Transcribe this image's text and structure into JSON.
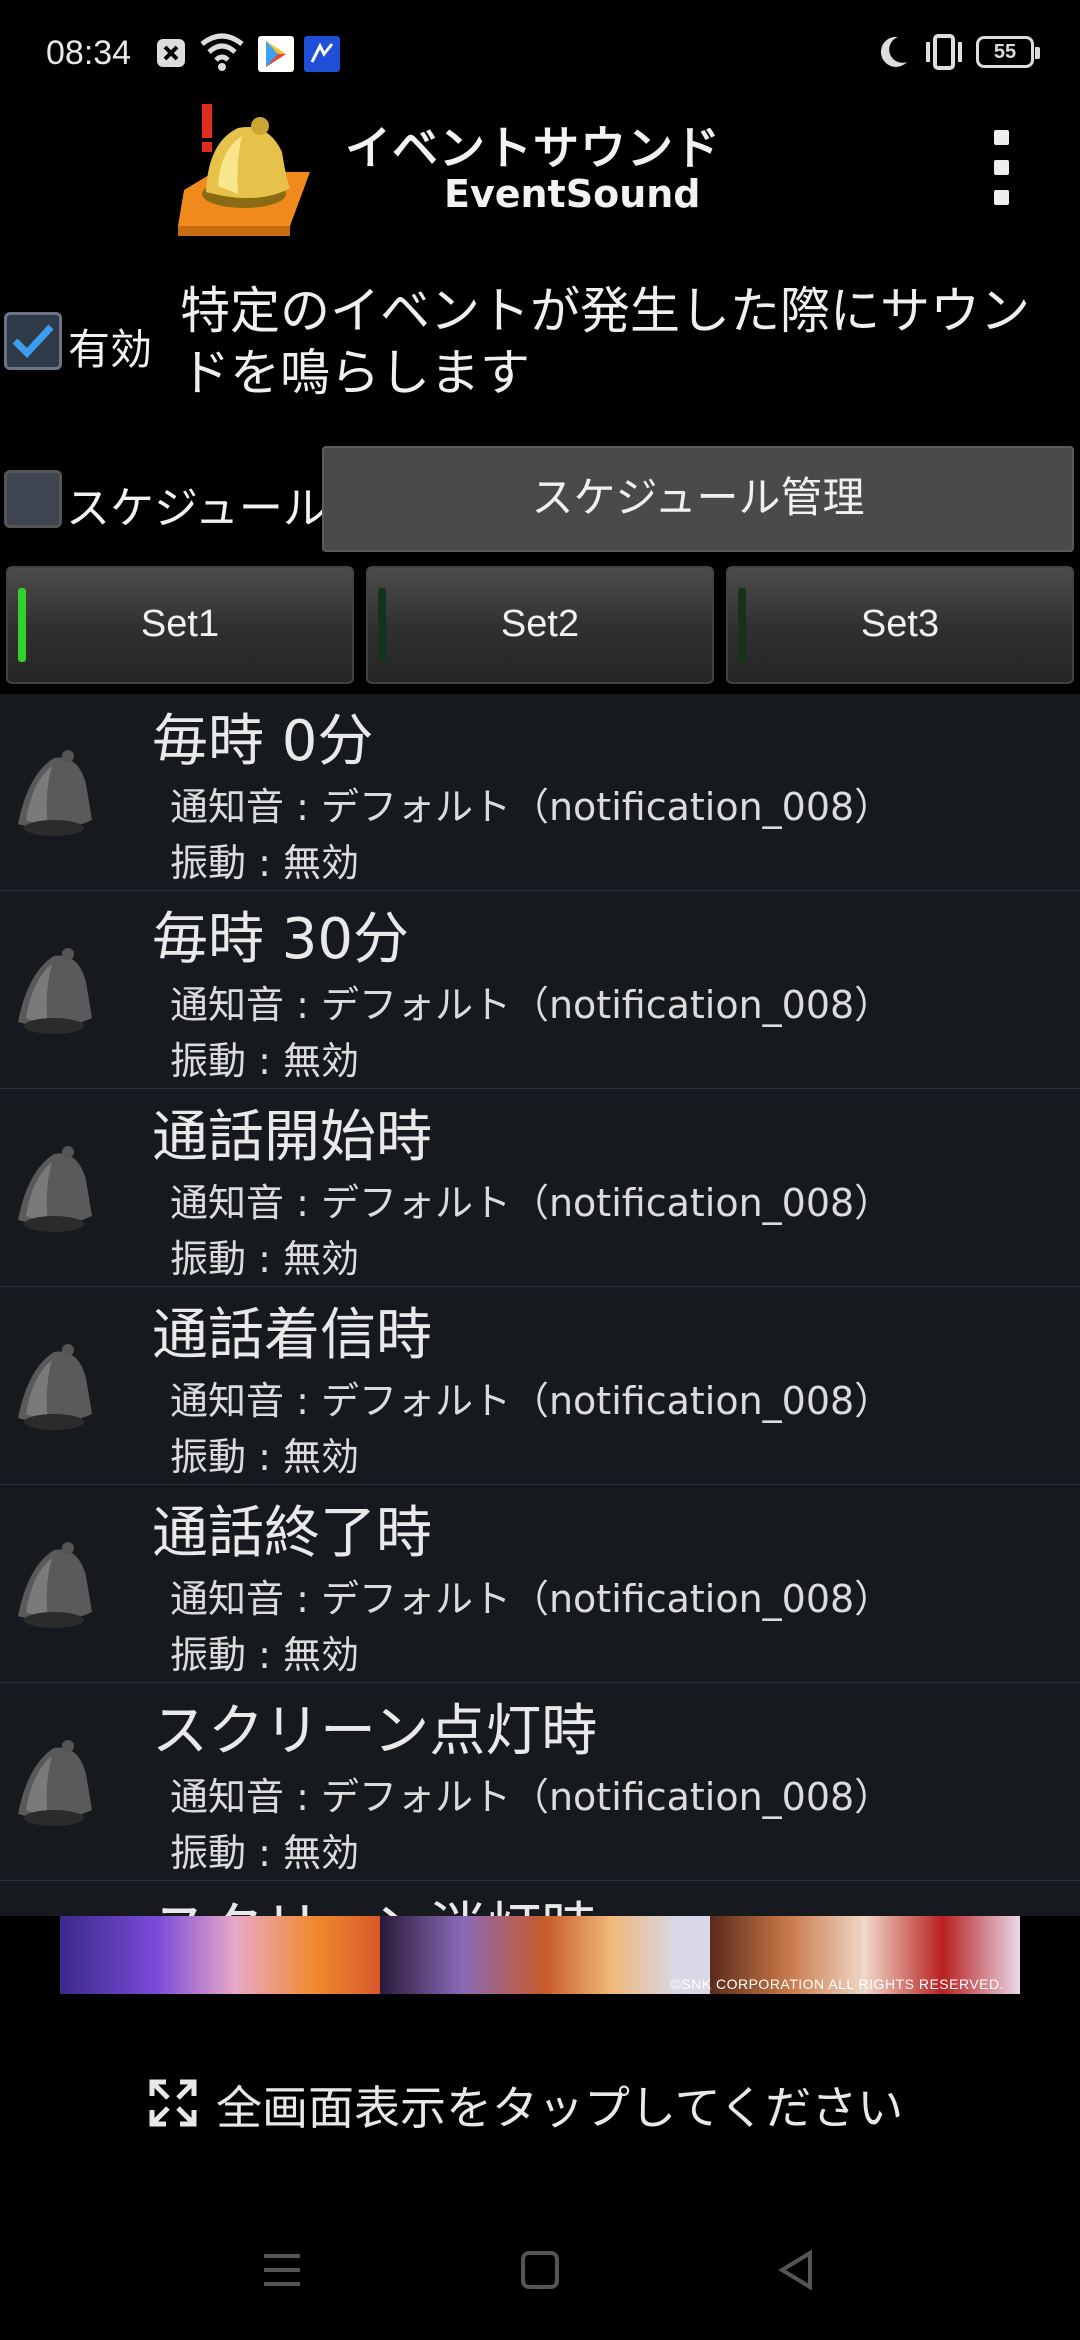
{
  "status_bar": {
    "time": "08:34",
    "battery": "55",
    "icons": [
      "close-box-icon",
      "wifi-icon",
      "play-store-icon",
      "app-notification-icon",
      "moon-icon",
      "vibrate-icon",
      "battery-icon"
    ]
  },
  "header": {
    "title_jp": "イベントサウンド",
    "title_en": "EventSound",
    "menu_icon": "overflow-menu-icon"
  },
  "enable": {
    "checked": true,
    "label": "有効",
    "description": "特定のイベントが発生した際にサウンドを鳴らします"
  },
  "schedule": {
    "checked": false,
    "label": "スケジュール",
    "manage_button": "スケジュール管理"
  },
  "sets": [
    {
      "label": "Set1",
      "active": true
    },
    {
      "label": "Set2",
      "active": false
    },
    {
      "label": "Set3",
      "active": false
    }
  ],
  "events": [
    {
      "title": "毎時 0分",
      "sound": "通知音 : デフォルト（notification_008）",
      "vibration": "振動 : 無効"
    },
    {
      "title": "毎時 30分",
      "sound": "通知音 : デフォルト（notification_008）",
      "vibration": "振動 : 無効"
    },
    {
      "title": "通話開始時",
      "sound": "通知音 : デフォルト（notification_008）",
      "vibration": "振動 : 無効"
    },
    {
      "title": "通話着信時",
      "sound": "通知音 : デフォルト（notification_008）",
      "vibration": "振動 : 無効"
    },
    {
      "title": "通話終了時",
      "sound": "通知音 : デフォルト（notification_008）",
      "vibration": "振動 : 無効"
    },
    {
      "title": "スクリーン点灯時",
      "sound": "通知音 : デフォルト（notification_008）",
      "vibration": "振動 : 無効"
    },
    {
      "title": "スクリーン消灯時",
      "sound": "",
      "vibration": ""
    }
  ],
  "ad": {
    "copyright": "©SNK CORPORATION ALL RIGHTS RESERVED."
  },
  "fullscreen": {
    "message": "全画面表示をタップしてください",
    "icon": "expand-icon"
  },
  "navbar": {
    "icons": [
      "menu-nav-icon",
      "home-nav-icon",
      "back-nav-icon"
    ]
  },
  "colors": {
    "accent_active": "#33d12f",
    "checkbox_check": "#3a9df0",
    "list_background": "#16191e"
  }
}
